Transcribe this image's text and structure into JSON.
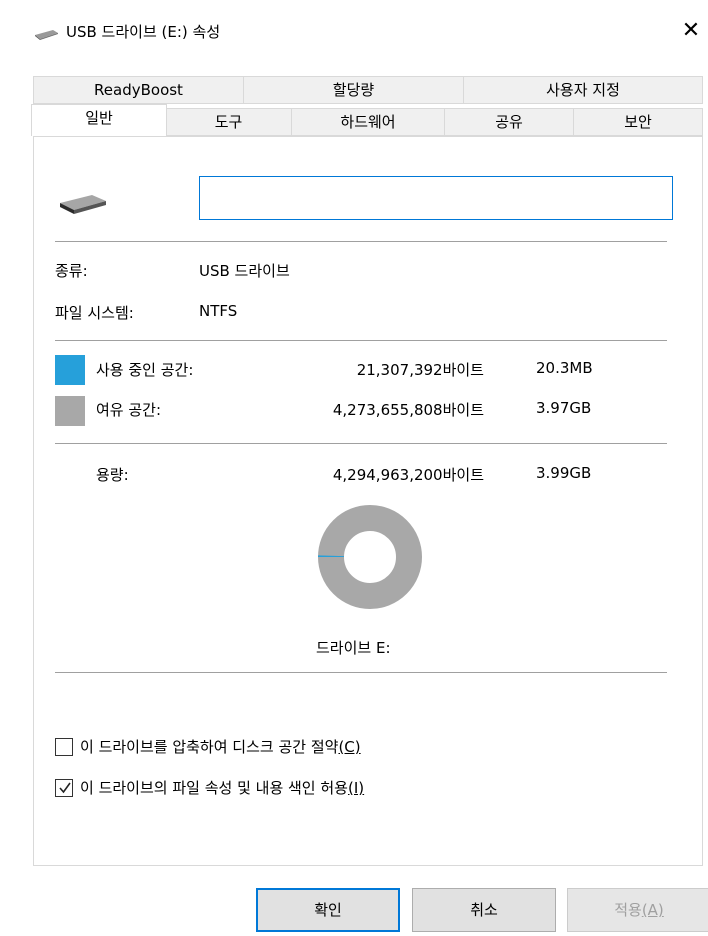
{
  "window": {
    "title": "USB 드라이브 (E:) 속성",
    "close_glyph": "✕"
  },
  "tabs": {
    "row_back": [
      "ReadyBoost",
      "할당량",
      "사용자 지정"
    ],
    "row_front": [
      "일반",
      "도구",
      "하드웨어",
      "공유",
      "보안"
    ],
    "active": "일반"
  },
  "general": {
    "name_value": "",
    "type_label": "종류:",
    "type_value": "USB 드라이브",
    "fs_label": "파일 시스템:",
    "fs_value": "NTFS",
    "used_label": "사용 중인 공간:",
    "used_bytes": "21,307,392바이트",
    "used_size": "20.3MB",
    "free_label": "여유 공간:",
    "free_bytes": "4,273,655,808바이트",
    "free_size": "3.97GB",
    "capacity_label": "용량:",
    "capacity_bytes": "4,294,963,200바이트",
    "capacity_size": "3.99GB",
    "drive_caption": "드라이브 E:",
    "used_fraction": 0.005,
    "used_color": "#26a0da",
    "free_color": "#a8a8a8"
  },
  "options": {
    "compress_label": "이 드라이브를 압축하여 디스크 공간 절약",
    "compress_key": "(C)",
    "compress_checked": false,
    "index_label": "이 드라이브의 파일 속성 및 내용 색인 허용",
    "index_key": "(I)",
    "index_checked": true
  },
  "buttons": {
    "ok": "확인",
    "cancel": "취소",
    "apply_text": "적용",
    "apply_key": "(A)"
  }
}
